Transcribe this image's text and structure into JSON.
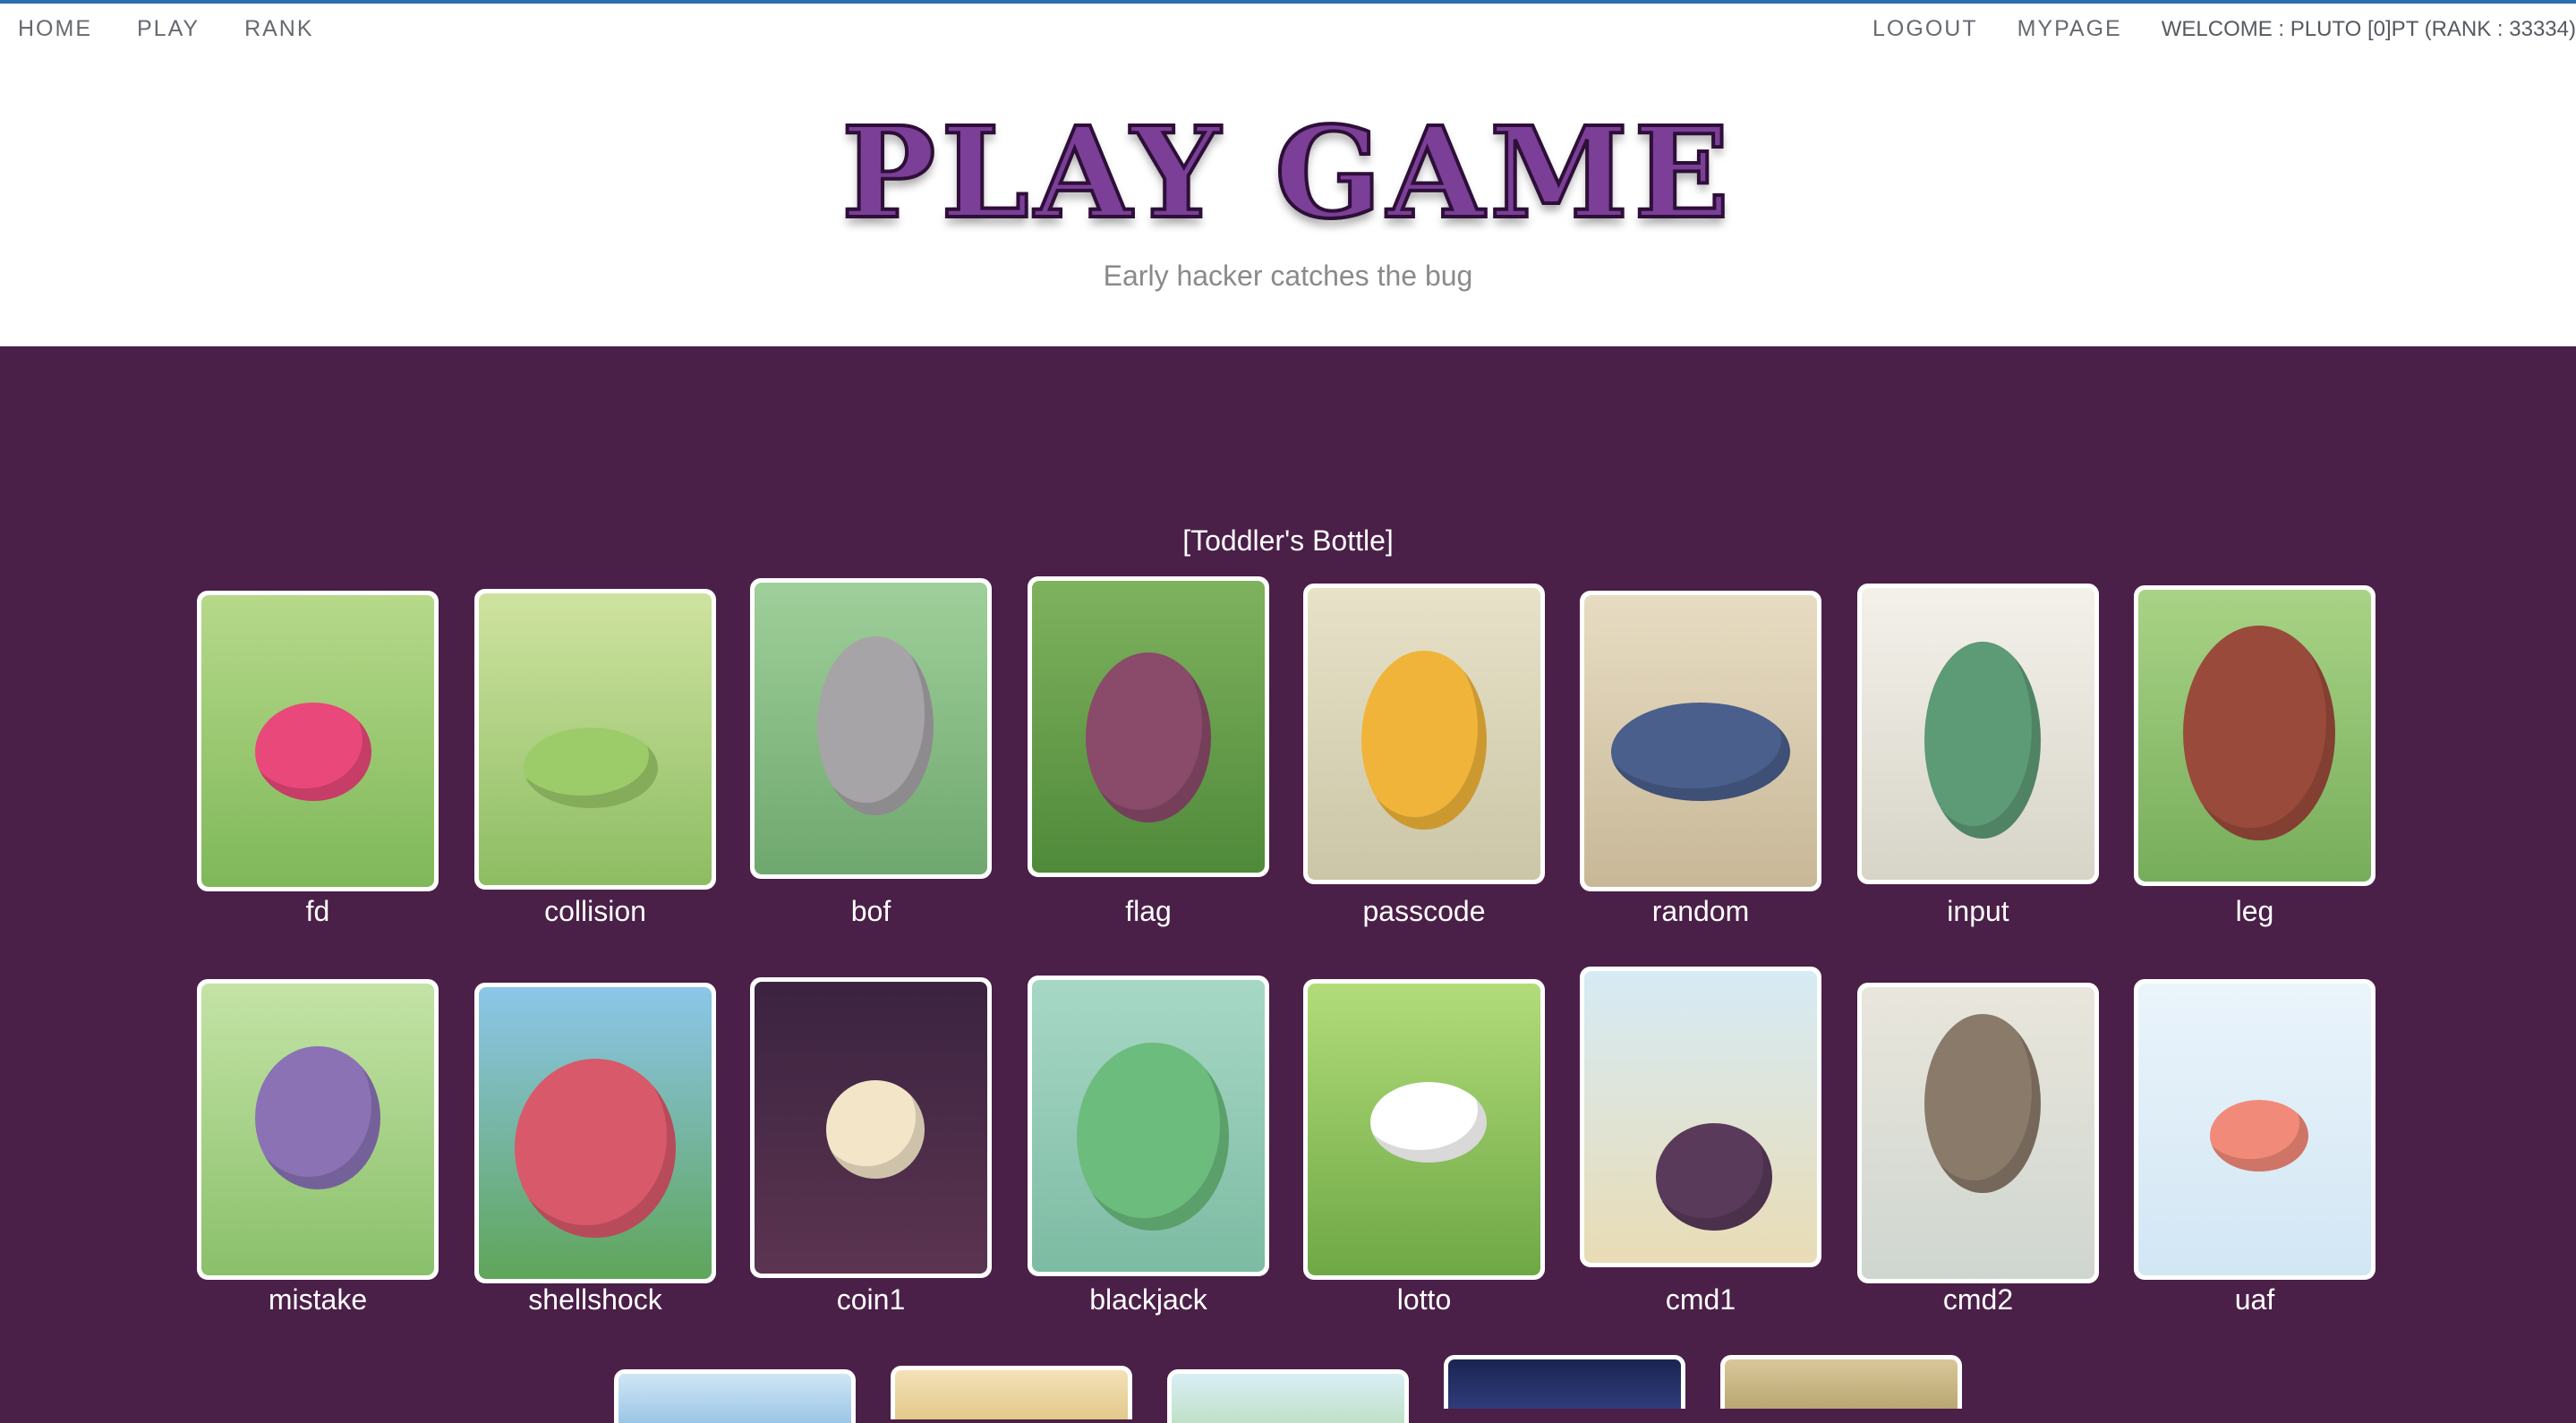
{
  "nav": {
    "home": "HOME",
    "play": "PLAY",
    "rank": "RANK",
    "logout": "LOGOUT",
    "mypage": "MYPAGE",
    "welcome": "WELCOME : PLUTO [0]PT (RANK : 33334)"
  },
  "hero": {
    "title": "PLAY GAME",
    "subtitle": "Early hacker catches the bug"
  },
  "category": "[Toddler's Bottle]",
  "games_row1": [
    {
      "name": "fd"
    },
    {
      "name": "collision"
    },
    {
      "name": "bof"
    },
    {
      "name": "flag"
    },
    {
      "name": "passcode"
    },
    {
      "name": "random"
    },
    {
      "name": "input"
    },
    {
      "name": "leg"
    }
  ],
  "games_row2": [
    {
      "name": "mistake"
    },
    {
      "name": "shellshock"
    },
    {
      "name": "coin1"
    },
    {
      "name": "blackjack"
    },
    {
      "name": "lotto"
    },
    {
      "name": "cmd1"
    },
    {
      "name": "cmd2"
    },
    {
      "name": "uaf"
    }
  ],
  "colors": {
    "accent": "#7b3f98",
    "background": "#4a1f48",
    "header_bg": "#ffffff"
  }
}
